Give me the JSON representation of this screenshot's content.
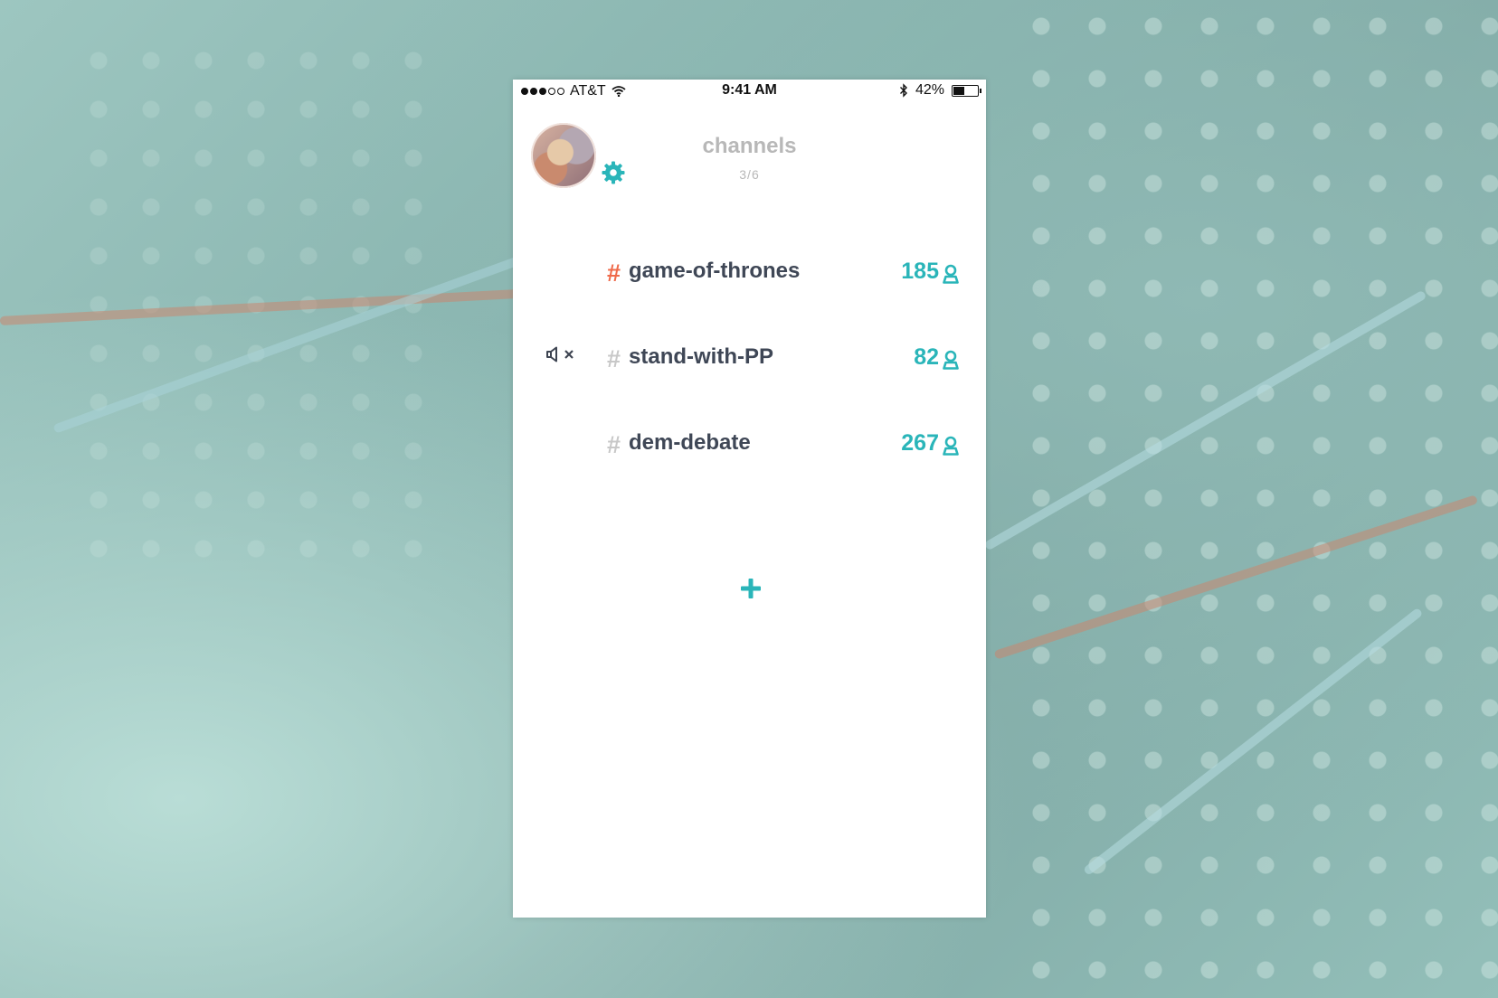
{
  "status_bar": {
    "carrier": "AT&T",
    "signal_bars": 3,
    "signal_total": 5,
    "time": "9:41 AM",
    "battery_percent": "42%",
    "battery_level": 0.42
  },
  "header": {
    "title": "channels",
    "count": "3/6"
  },
  "channels": [
    {
      "name": "game-of-thrones",
      "members": "185",
      "active": true,
      "muted": false
    },
    {
      "name": "stand-with-PP",
      "members": "82",
      "active": false,
      "muted": true
    },
    {
      "name": "dem-debate",
      "members": "267",
      "active": false,
      "muted": false
    }
  ],
  "colors": {
    "accent": "#2ab5b9",
    "active_hash": "#ef6a4a",
    "inactive_hash": "#c8c8c8",
    "channel_text": "#3f4756",
    "header_text": "#b8b8b8"
  },
  "icons": {
    "settings": "gear-icon",
    "members": "person-icon",
    "mute": "muted-speaker-icon",
    "add": "plus-icon",
    "wifi": "wifi-icon",
    "bluetooth": "bluetooth-icon",
    "battery": "battery-icon"
  }
}
